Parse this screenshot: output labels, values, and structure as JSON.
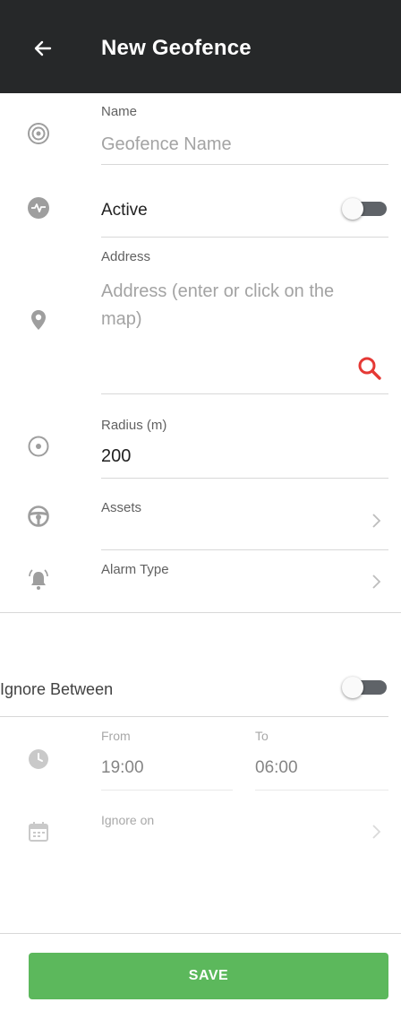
{
  "app_bar": {
    "title": "New Geofence",
    "back_icon": "arrow-left-icon"
  },
  "name": {
    "label": "Name",
    "placeholder": "Geofence Name",
    "icon": "target-icon"
  },
  "active": {
    "label": "Active",
    "icon": "activity-icon",
    "enabled": false
  },
  "address": {
    "label": "Address",
    "placeholder": "Address (enter or click on the map)",
    "icon": "location-pin-icon",
    "search_icon": "search-icon"
  },
  "radius": {
    "label": "Radius (m)",
    "value": "200",
    "icon": "radio-target-icon"
  },
  "assets": {
    "label": "Assets",
    "icon": "steering-wheel-icon"
  },
  "alarm_type": {
    "label": "Alarm Type",
    "icon": "alarm-bell-icon"
  },
  "ignore_between": {
    "label": "Ignore Between",
    "enabled": false
  },
  "time_range": {
    "from_label": "From",
    "from_value": "19:00",
    "to_label": "To",
    "to_value": "06:00",
    "icon": "clock-icon"
  },
  "ignore_on": {
    "label": "Ignore on",
    "icon": "calendar-icon"
  },
  "save_button": {
    "label": "SAVE"
  },
  "colors": {
    "app_bar": "#262829",
    "save": "#5cb85c",
    "search": "#e53935",
    "icon": "#9e9e9e"
  }
}
